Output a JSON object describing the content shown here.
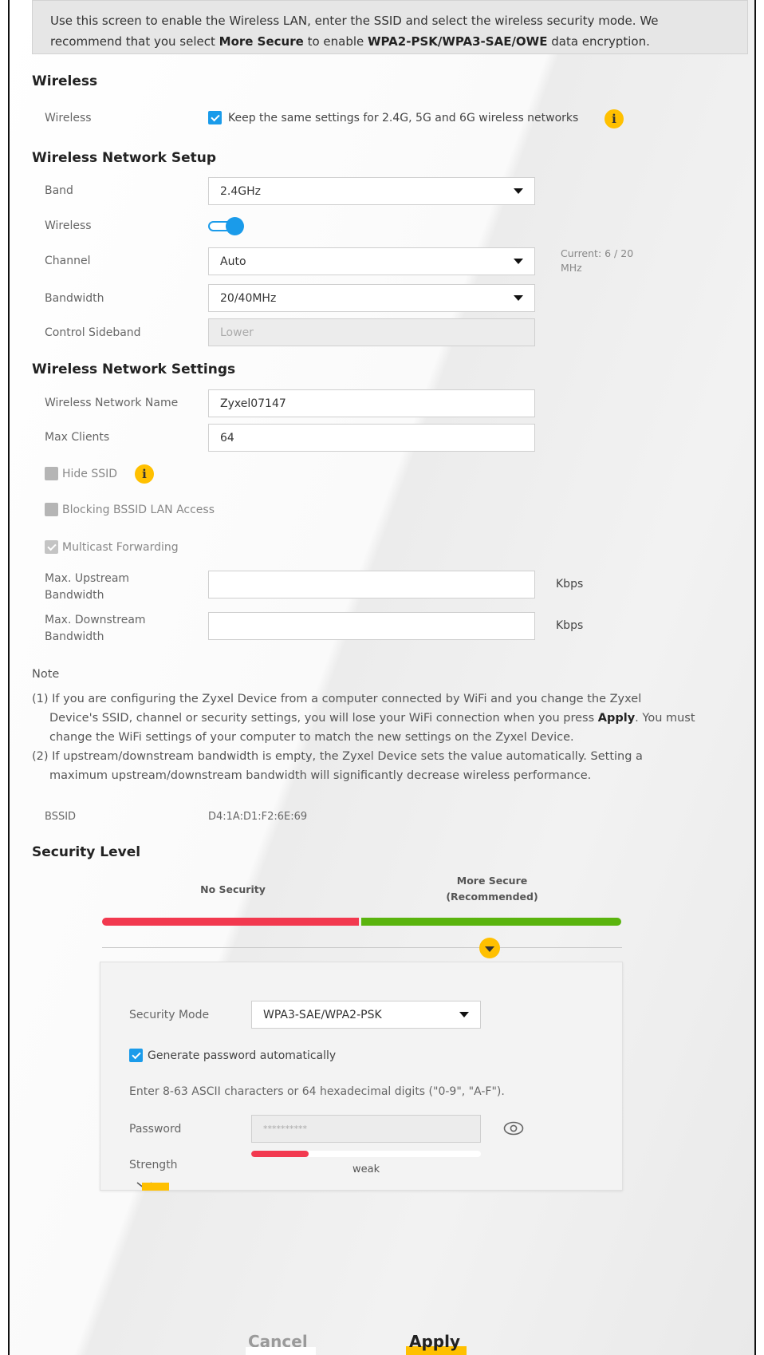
{
  "intro": {
    "line1": "Use this screen to enable the Wireless LAN, enter the SSID and select the wireless security mode. We",
    "line2_a": "recommend that you select ",
    "line2_b": "More Secure",
    "line2_c": " to enable ",
    "line2_d": "WPA2-PSK/WPA3-SAE/OWE",
    "line2_e": " data encryption."
  },
  "wireless": {
    "section_title": "Wireless",
    "label": "Wireless",
    "keep_same_label": "Keep the same settings for 2.4G, 5G and 6G wireless networks",
    "keep_same_checked": true
  },
  "setup": {
    "section_title": "Wireless Network Setup",
    "band_label": "Band",
    "band_value": "2.4GHz",
    "wireless_label": "Wireless",
    "wireless_enabled": true,
    "channel_label": "Channel",
    "channel_value": "Auto",
    "current_line1": "Current: 6 / 20",
    "current_line2": "MHz",
    "bandwidth_label": "Bandwidth",
    "bandwidth_value": "20/40MHz",
    "sideband_label": "Control Sideband",
    "sideband_value": "Lower"
  },
  "settings": {
    "section_title": "Wireless Network Settings",
    "ssid_label": "Wireless Network Name",
    "ssid_value": "Zyxel07147",
    "max_clients_label": "Max Clients",
    "max_clients_value": "64",
    "hide_ssid_label": "Hide SSID",
    "blocking_label": "Blocking BSSID LAN Access",
    "multicast_label": "Multicast Forwarding",
    "up_label_1": "Max. Upstream",
    "up_label_2": "Bandwidth",
    "down_label_1": "Max. Downstream",
    "down_label_2": "Bandwidth",
    "unit": "Kbps"
  },
  "note": {
    "title": "Note",
    "n1_l1": "(1) If you are configuring the Zyxel Device from a computer connected by WiFi and you change the Zyxel",
    "n1_l2_a": "Device's SSID, channel or security settings, you will lose your WiFi connection when you press ",
    "n1_l2_b": "Apply",
    "n1_l2_c": ". You must",
    "n1_l3": "change the WiFi settings of your computer to match the new settings on the Zyxel Device.",
    "n2_l1": "(2) If upstream/downstream bandwidth is empty, the Zyxel Device sets the value automatically. Setting a",
    "n2_l2": "maximum upstream/downstream bandwidth will significantly decrease wireless performance."
  },
  "bssid": {
    "label": "BSSID",
    "value": "D4:1A:D1:F2:6E:69"
  },
  "security": {
    "section_title": "Security Level",
    "no_security": "No Security",
    "more_secure_1": "More Secure",
    "more_secure_2": "(Recommended)",
    "mode_label": "Security Mode",
    "mode_value": "WPA3-SAE/WPA2-PSK",
    "generate_label": "Generate password automatically",
    "hint": "Enter 8-63 ASCII characters or 64 hexadecimal digits (\"0-9\", \"A-F\").",
    "password_label": "Password",
    "password_value": "**********",
    "strength_label": "Strength",
    "strength_value": "weak",
    "strength_fraction": 0.25
  },
  "actions": {
    "cancel": "Cancel",
    "apply": "Apply"
  },
  "colors": {
    "accent": "#1a9bea",
    "info": "#ffc000",
    "red": "#f2394f",
    "green": "#5ab40e"
  }
}
